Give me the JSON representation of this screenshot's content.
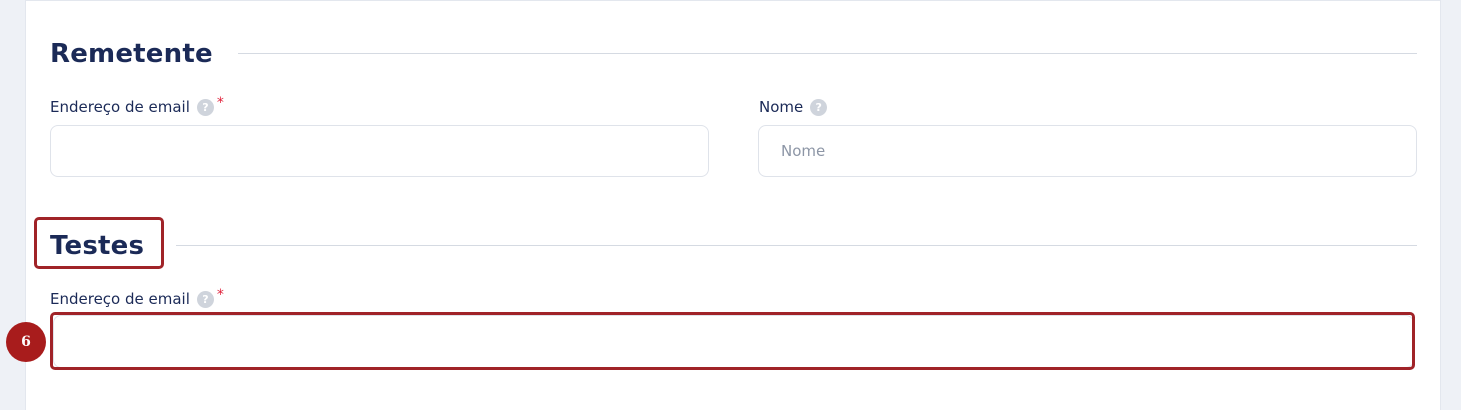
{
  "sender_section": {
    "title": "Remetente",
    "email_label": "Endereço de email",
    "email_required_mark": "*",
    "email_value": "",
    "name_label": "Nome",
    "name_placeholder": "Nome",
    "name_value": ""
  },
  "test_section": {
    "title": "Testes",
    "email_label": "Endereço de email",
    "email_required_mark": "*",
    "email_value": ""
  },
  "help_icon_glyph": "?",
  "annotation": {
    "step_number": "6",
    "highlight_color": "#a02328",
    "badge_color": "#a81c1c"
  },
  "colors": {
    "heading": "#1b2a57",
    "required": "#e0203a",
    "border": "#dfe3ea",
    "background": "#eef1f6"
  }
}
